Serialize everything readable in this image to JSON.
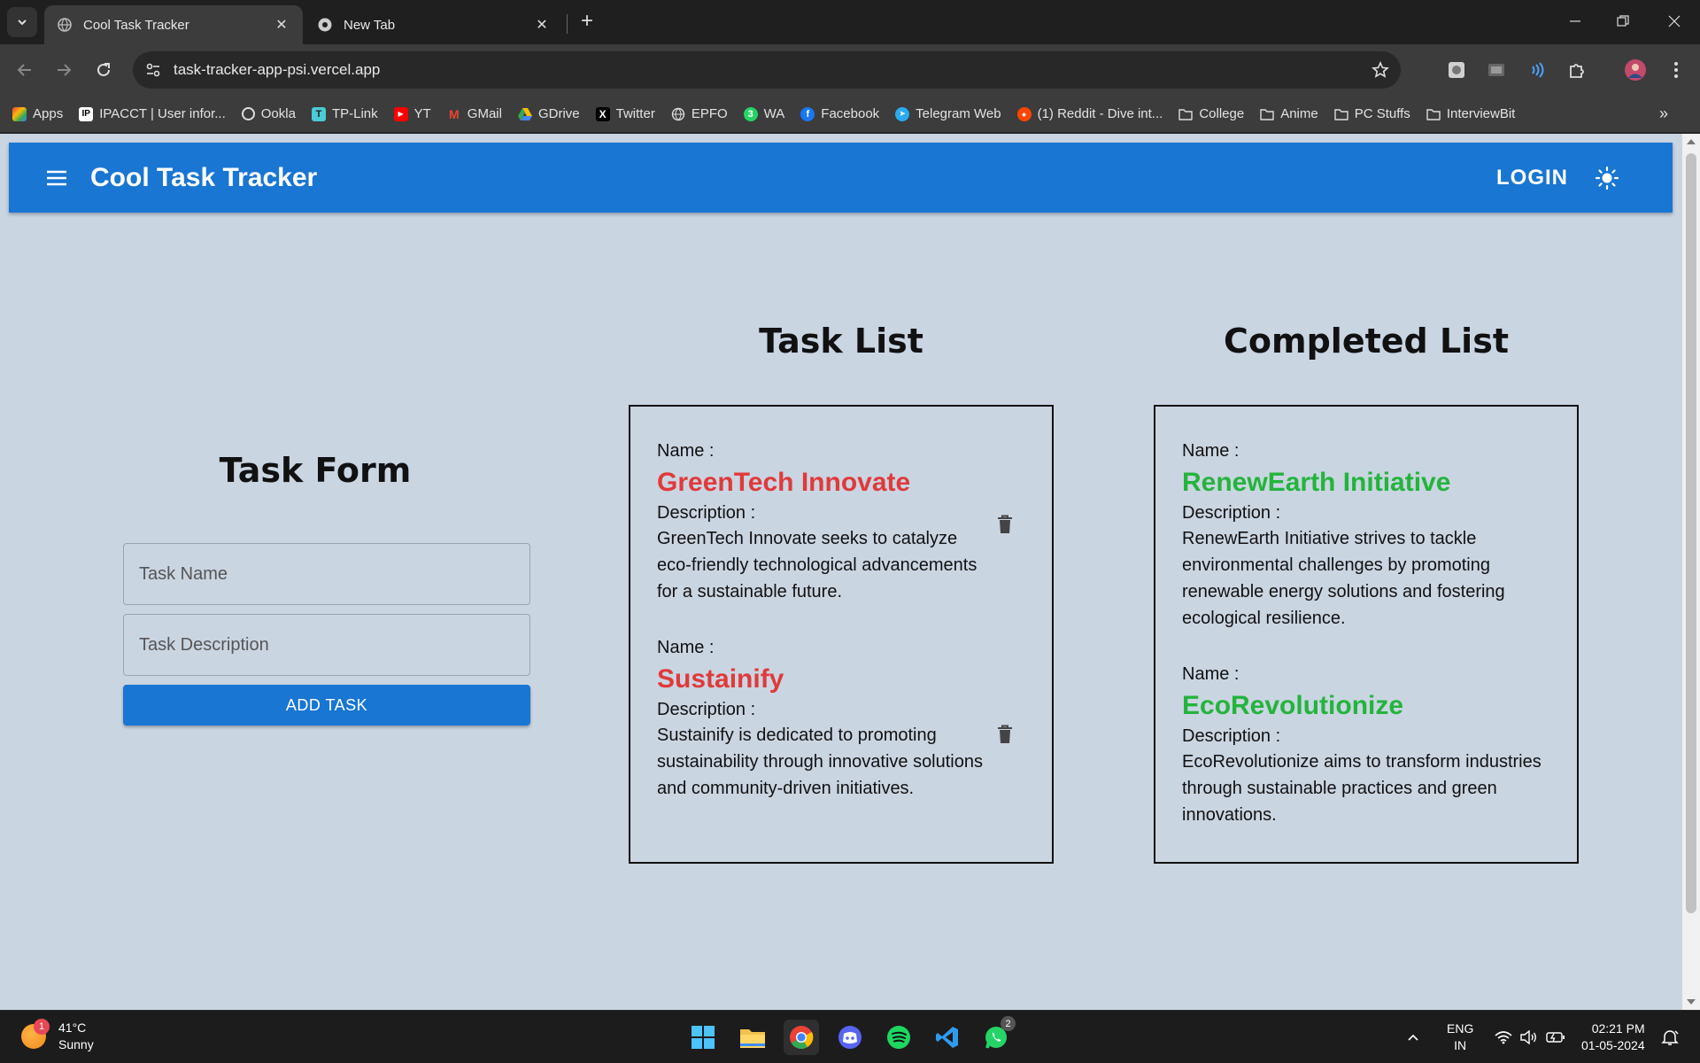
{
  "browser": {
    "tabs": [
      {
        "title": "Cool Task Tracker",
        "active": true
      },
      {
        "title": "New Tab",
        "active": false
      }
    ],
    "url": "task-tracker-app-psi.vercel.app",
    "bookmarks": [
      {
        "label": "Apps",
        "icon": "apps-grid-icon"
      },
      {
        "label": "IPACCT | User infor...",
        "icon": "ipacct-icon"
      },
      {
        "label": "Ookla",
        "icon": "ookla-icon"
      },
      {
        "label": "TP-Link",
        "icon": "tplink-icon"
      },
      {
        "label": "YT",
        "icon": "youtube-icon"
      },
      {
        "label": "GMail",
        "icon": "gmail-icon"
      },
      {
        "label": "GDrive",
        "icon": "gdrive-icon"
      },
      {
        "label": "Twitter",
        "icon": "x-icon"
      },
      {
        "label": "EPFO",
        "icon": "globe-icon"
      },
      {
        "label": "WA",
        "icon": "whatsapp-icon"
      },
      {
        "label": "Facebook",
        "icon": "facebook-icon"
      },
      {
        "label": "Telegram Web",
        "icon": "telegram-icon"
      },
      {
        "label": "(1) Reddit - Dive int...",
        "icon": "reddit-icon"
      },
      {
        "label": "College",
        "icon": "folder-icon"
      },
      {
        "label": "Anime",
        "icon": "folder-icon"
      },
      {
        "label": "PC Stuffs",
        "icon": "folder-icon"
      },
      {
        "label": "InterviewBit",
        "icon": "folder-icon"
      }
    ]
  },
  "app": {
    "title": "Cool Task Tracker",
    "login_label": "LOGIN",
    "accent": "#1976d2"
  },
  "form": {
    "heading": "Task Form",
    "name_placeholder": "Task Name",
    "desc_placeholder": "Task Description",
    "add_label": "ADD TASK"
  },
  "task_list": {
    "heading": "Task List",
    "name_label": "Name :",
    "desc_label": "Description :",
    "items": [
      {
        "name": "GreenTech Innovate",
        "description": "GreenTech Innovate seeks to catalyze eco-friendly technological advancements for a sustainable future."
      },
      {
        "name": "Sustainify",
        "description": "Sustainify is dedicated to promoting sustainability through innovative solutions and community-driven initiatives."
      }
    ]
  },
  "completed_list": {
    "heading": "Completed List",
    "name_label": "Name :",
    "desc_label": "Description :",
    "items": [
      {
        "name": "RenewEarth Initiative",
        "description": "RenewEarth Initiative strives to tackle environmental challenges by promoting renewable energy solutions and fostering ecological resilience."
      },
      {
        "name": "EcoRevolutionize",
        "description": "EcoRevolutionize aims to transform industries through sustainable practices and green innovations."
      }
    ]
  },
  "taskbar": {
    "weather_temp": "41°C",
    "weather_text": "Sunny",
    "weather_badge": "1",
    "whatsapp_badge": "2",
    "lang_1": "ENG",
    "lang_2": "IN",
    "time": "02:21 PM",
    "date": "01-05-2024"
  }
}
